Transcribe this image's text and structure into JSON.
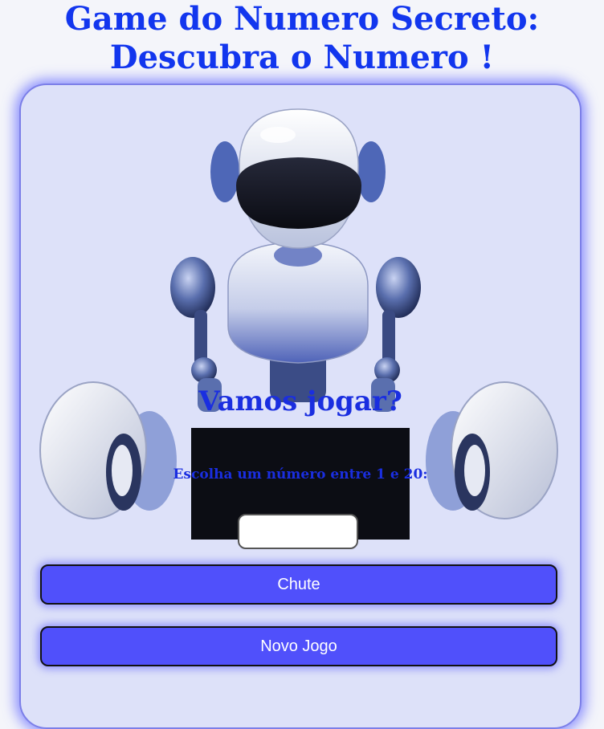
{
  "header": {
    "title_line1": "Game do Numero Secreto:",
    "title_line2": "Descubra o Numero !"
  },
  "game": {
    "heading": "Vamos jogar?",
    "instruction": "Escolha um número entre 1 e 20:",
    "guess_input_value": "",
    "guess_button_label": "Chute",
    "new_game_button_label": "Novo Jogo"
  },
  "colors": {
    "title": "#1236ee",
    "card_background": "#dde1f9",
    "button": "#5050fb",
    "button_text": "#ffffff"
  }
}
